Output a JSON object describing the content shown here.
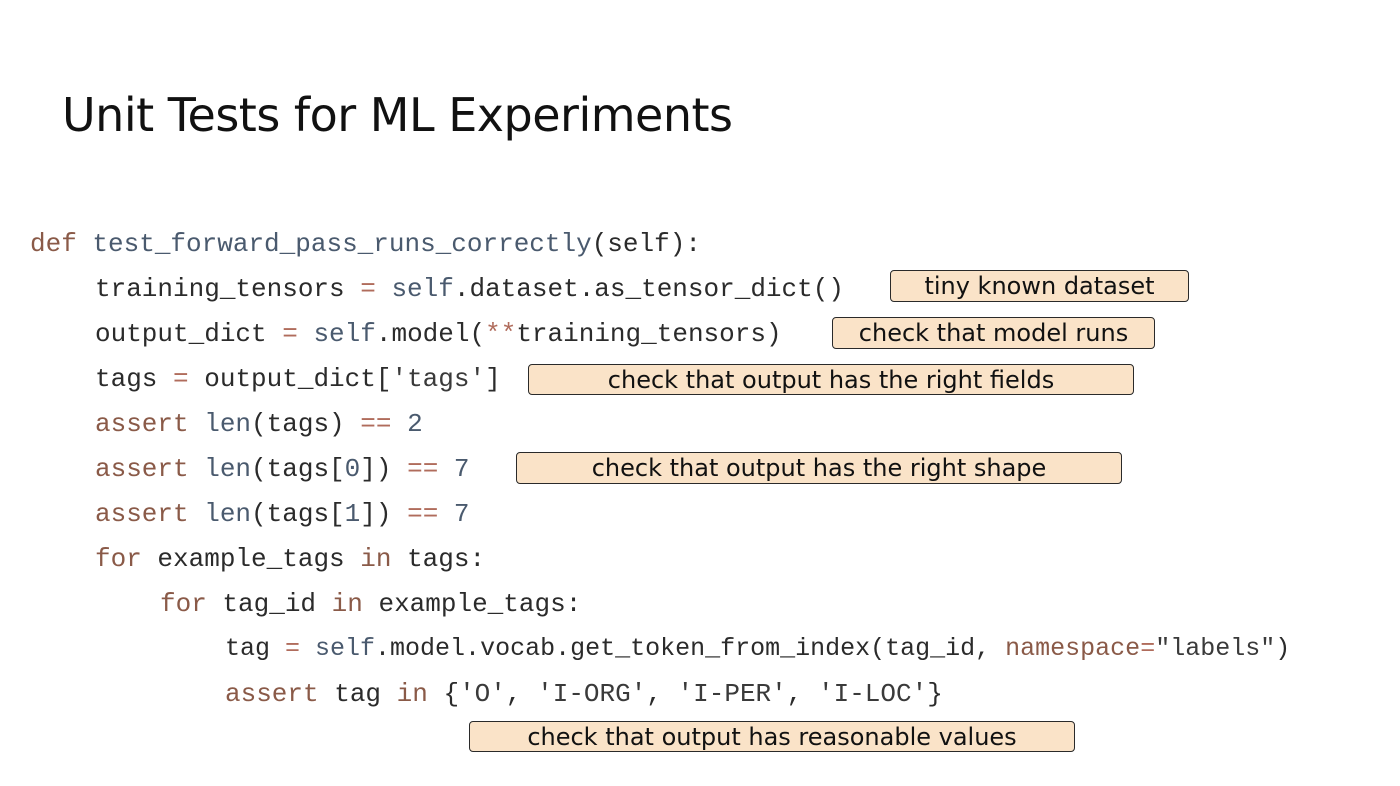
{
  "title": "Unit Tests for ML Experiments",
  "code": {
    "l1": {
      "kw": "def",
      "fn": "test_forward_pass_runs_correctly",
      "rest": "(self):"
    },
    "l2": {
      "a": "training_tensors",
      "op": " = ",
      "self": "self",
      "b": ".dataset.as_tensor_dict()"
    },
    "l3": {
      "a": "output_dict",
      "op": " = ",
      "self": "self",
      "b": ".model(",
      "op2": "**",
      "c": "training_tensors)"
    },
    "l4": {
      "a": "tags",
      "op": " = ",
      "b": "output_dict[",
      "str": "'tags'",
      "c": "]"
    },
    "l5": {
      "kw": "assert",
      "fn": " len",
      "b": "(tags) ",
      "op": "==",
      "num": " 2"
    },
    "l6": {
      "kw": "assert",
      "fn": " len",
      "b": "(tags[",
      "n0": "0",
      "c": "]) ",
      "op": "==",
      "num": " 7"
    },
    "l7": {
      "kw": "assert",
      "fn": " len",
      "b": "(tags[",
      "n1": "1",
      "c": "]) ",
      "op": "==",
      "num": " 7"
    },
    "l8": {
      "kw": "for",
      "a": " example_tags ",
      "kw2": "in",
      "b": " tags:"
    },
    "l9": {
      "kw": "for",
      "a": " tag_id ",
      "kw2": "in",
      "b": " example_tags:"
    },
    "l10": {
      "a": "tag",
      "op": " = ",
      "self": "self",
      "b": ".model.vocab.get_token_from_index(tag_id, ",
      "param": "namespace",
      "op2": "=",
      "str": "\"labels\"",
      "c": ")"
    },
    "l11": {
      "kw": "assert",
      "a": " tag ",
      "kw2": "in",
      "b": " {",
      "s1": "'O'",
      "c1": ", ",
      "s2": "'I-ORG'",
      "c2": ", ",
      "s3": "'I-PER'",
      "c3": ", ",
      "s4": "'I-LOC'",
      "c4": "}"
    }
  },
  "callouts": {
    "dataset": "tiny known dataset",
    "runs": "check that model runs",
    "fields": "check that output has the right fields",
    "shape": "check that output has the right shape",
    "values": "check that output has reasonable values"
  }
}
